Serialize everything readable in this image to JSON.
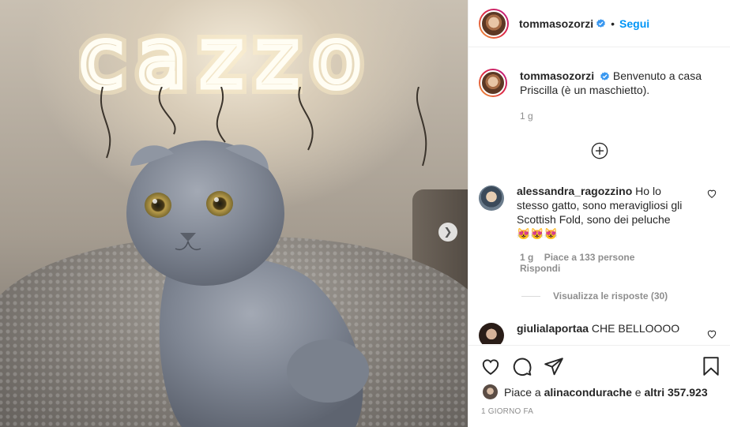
{
  "post_image": {
    "neon_text": "cazzo"
  },
  "header": {
    "username": "tommasozorzi",
    "separator": "•",
    "follow_label": "Segui"
  },
  "caption": {
    "username": "tommasozorzi",
    "text": "Benvenuto a casa Priscilla (è un maschietto).",
    "age": "1 g"
  },
  "comments": [
    {
      "username": "alessandra_ragozzino",
      "text": "Ho lo stesso gatto, sono meravigliosi gli Scottish Fold, sono dei peluche 😻😻😻",
      "age": "1 g",
      "likes": "Piace a 133 persone",
      "reply_label": "Rispondi",
      "view_replies": "Visualizza le risposte (30)"
    },
    {
      "username": "giulialaportaa",
      "text": "CHE BELLOOOO"
    }
  ],
  "likes": {
    "prefix": "Piace a ",
    "user": "alinacondurache",
    "middle": " e ",
    "others": "altri 357.923"
  },
  "timestamp": "1 GIORNO FA",
  "icons": {
    "verified": "verified-badge-icon",
    "add": "add-circle-icon",
    "like": "heart-icon",
    "comment": "comment-bubble-icon",
    "share": "paper-plane-icon",
    "save": "bookmark-icon",
    "next": "chevron-right-icon"
  },
  "colors": {
    "accent": "#0095f6",
    "verified": "#3897f0",
    "secondary_text": "#8e8e8e"
  }
}
